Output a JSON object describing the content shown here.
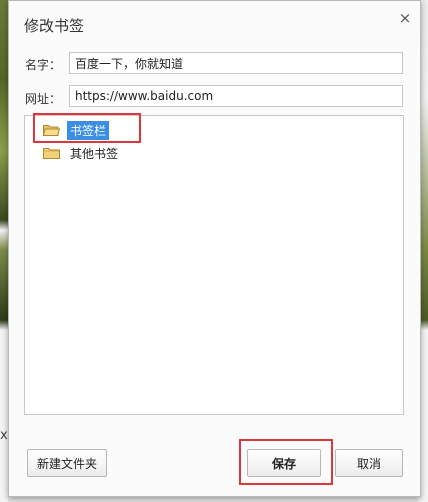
{
  "dialog": {
    "title": "修改书签",
    "close_glyph": "×"
  },
  "form": {
    "name_label": "名字：",
    "name_value": "百度一下，你就知道",
    "url_label": "网址：",
    "url_value": "https://www.baidu.com"
  },
  "tree": {
    "items": [
      {
        "label": "书签栏",
        "selected": true,
        "icon": "folder-open-icon"
      },
      {
        "label": "其他书签",
        "selected": false,
        "icon": "folder-icon"
      }
    ]
  },
  "buttons": {
    "new_folder": "新建文件夹",
    "save": "保存",
    "cancel": "取消"
  },
  "background": {
    "glyph_a": "x",
    "glyph_b": "…"
  },
  "colors": {
    "selection": "#3a8ee6",
    "highlight_border": "#e0353a"
  }
}
